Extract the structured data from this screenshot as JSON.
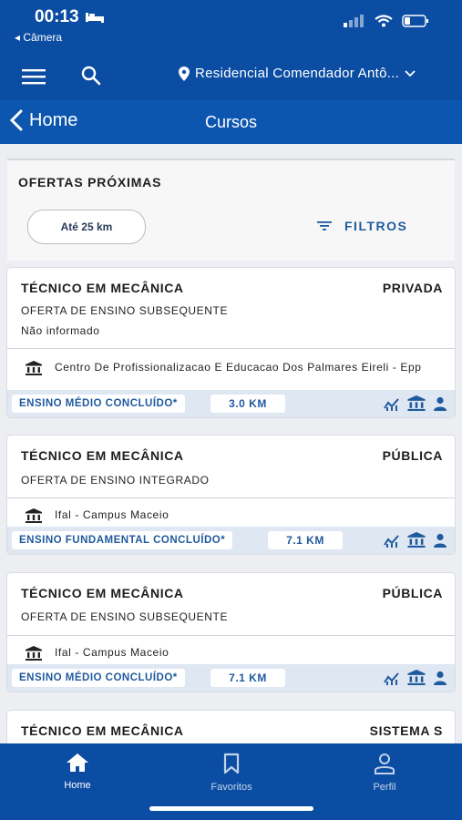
{
  "status": {
    "time": "00:13",
    "back_app": "◂ Câmera"
  },
  "header": {
    "location": "Residencial Comendador Antô..."
  },
  "nav": {
    "back_label": "Home",
    "title": "Cursos"
  },
  "filters": {
    "section_title": "OFERTAS PRÓXIMAS",
    "distance_chip": "Até 25 km",
    "filters_label": "FILTROS"
  },
  "offers": [
    {
      "course": "TÉCNICO EM MECÂNICA",
      "type": "PRIVADA",
      "offer": "OFERTA DE ENSINO SUBSEQUENTE",
      "shift": "Não informado",
      "institution": "Centro De Profissionalizacao E Educacao Dos Palmares Eireli - Epp",
      "requirement": "ENSINO MÉDIO CONCLUÍDO*",
      "distance": "3.0 KM"
    },
    {
      "course": "TÉCNICO EM MECÂNICA",
      "type": "PÚBLICA",
      "offer": "OFERTA DE ENSINO INTEGRADO",
      "institution": "Ifal - Campus Maceio",
      "requirement": "ENSINO FUNDAMENTAL CONCLUÍDO*",
      "distance": "7.1 KM"
    },
    {
      "course": "TÉCNICO EM MECÂNICA",
      "type": "PÚBLICA",
      "offer": "OFERTA DE ENSINO SUBSEQUENTE",
      "institution": "Ifal - Campus Maceio",
      "requirement": "ENSINO MÉDIO CONCLUÍDO*",
      "distance": "7.1 KM"
    },
    {
      "course": "TÉCNICO EM MECÂNICA",
      "type": "SISTEMA S"
    }
  ],
  "tabs": [
    {
      "label": "Home"
    },
    {
      "label": "Favoritos"
    },
    {
      "label": "Perfil"
    }
  ],
  "colors": {
    "brand": "#0b4da3",
    "accent_text": "#1f5a9e",
    "footer_bg": "#dfe7f2"
  }
}
